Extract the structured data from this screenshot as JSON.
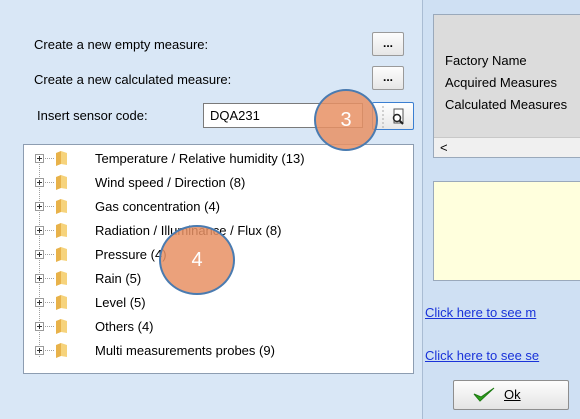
{
  "form": {
    "empty_measure_label": "Create a new empty  measure:",
    "calculated_measure_label": "Create a new calculated  measure:",
    "sensor_code_label": "Insert sensor code:",
    "sensor_code_value": "DQA231",
    "browse_label": "..."
  },
  "tree": {
    "items": [
      {
        "label": "Temperature / Relative humidity (13)"
      },
      {
        "label": "Wind speed  / Direction (8)"
      },
      {
        "label": "Gas concentration (4)"
      },
      {
        "label": "Radiation / Illuminance / Flux (8)"
      },
      {
        "label": "Pressure (4)"
      },
      {
        "label": "Rain (5)"
      },
      {
        "label": "Level (5)"
      },
      {
        "label": "Others (4)"
      },
      {
        "label": "Multi measurements probes (9)"
      }
    ]
  },
  "callouts": {
    "first": "3",
    "second": "4"
  },
  "info": {
    "factory_name": "Factory Name",
    "acquired": "Acquired Measures",
    "calculated": "Calculated Measures",
    "scroll_left": "<"
  },
  "links": {
    "first": "Click here to see m",
    "second": "Click here to see se"
  },
  "ok_button": {
    "label": "Ok"
  },
  "colors": {
    "accent": "#1a33d9",
    "callout": "#e79164",
    "panel": "#d9e7f6"
  }
}
